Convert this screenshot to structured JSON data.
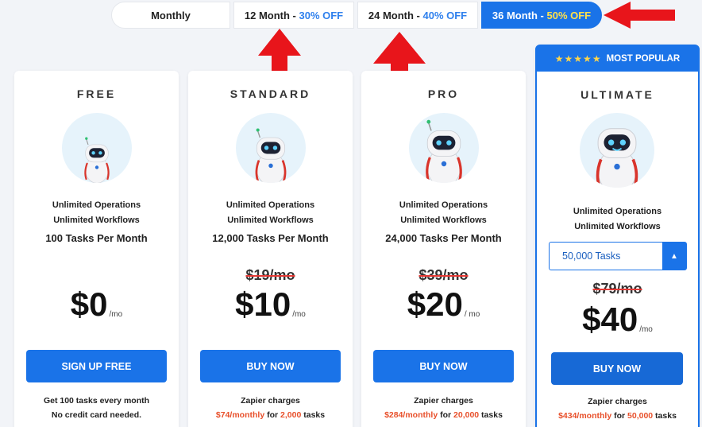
{
  "tabs": {
    "monthly": "Monthly",
    "m12_label": "12 Month - ",
    "m12_discount": "30% OFF",
    "m24_label": "24 Month - ",
    "m24_discount": "40% OFF",
    "m36_label": "36 Month - ",
    "m36_discount": "50% OFF",
    "selected": "36 Month"
  },
  "colors": {
    "accent": "#1a73e8",
    "arrow": "#e8151b",
    "highlight": "#e8502b",
    "discount_text": "#ffe14d"
  },
  "plans": {
    "free": {
      "name": "FREE",
      "feature1": "Unlimited Operations",
      "feature2": "Unlimited Workflows",
      "tasks": "100 Tasks Per Month",
      "price": "$0",
      "per": "/mo",
      "button": "SIGN UP FREE",
      "note1": "Get 100 tasks every month",
      "note2": "No credit card needed."
    },
    "standard": {
      "name": "STANDARD",
      "feature1": "Unlimited Operations",
      "feature2": "Unlimited Workflows",
      "tasks": "12,000 Tasks Per Month",
      "old_price": "$19/mo",
      "price": "$10",
      "per": "/mo",
      "button": "BUY NOW",
      "note1": "Zapier charges",
      "note2_red": "$74/monthly",
      "note2_mid": " for ",
      "note2_red2": "2,000",
      "note2_tail": " tasks"
    },
    "pro": {
      "name": "PRO",
      "feature1": "Unlimited Operations",
      "feature2": "Unlimited Workflows",
      "tasks": "24,000 Tasks Per Month",
      "old_price": "$39/mo",
      "price": "$20",
      "per": "/ mo",
      "button": "BUY NOW",
      "note1": "Zapier charges",
      "note2_red": "$284/monthly",
      "note2_mid": " for ",
      "note2_red2": "20,000",
      "note2_tail": " tasks"
    },
    "ultimate": {
      "ribbon_stars": "★★★★★",
      "ribbon": "MOST POPULAR",
      "name": "ULTIMATE",
      "feature1": "Unlimited Operations",
      "feature2": "Unlimited Workflows",
      "task_select": "50,000 Tasks",
      "caret": "▲",
      "old_price": "$79/mo",
      "price": "$40",
      "per": "/mo",
      "button": "BUY NOW",
      "note1": "Zapier charges",
      "note2_red": "$434/monthly",
      "note2_mid": " for ",
      "note2_red2": "50,000",
      "note2_tail": " tasks"
    }
  }
}
